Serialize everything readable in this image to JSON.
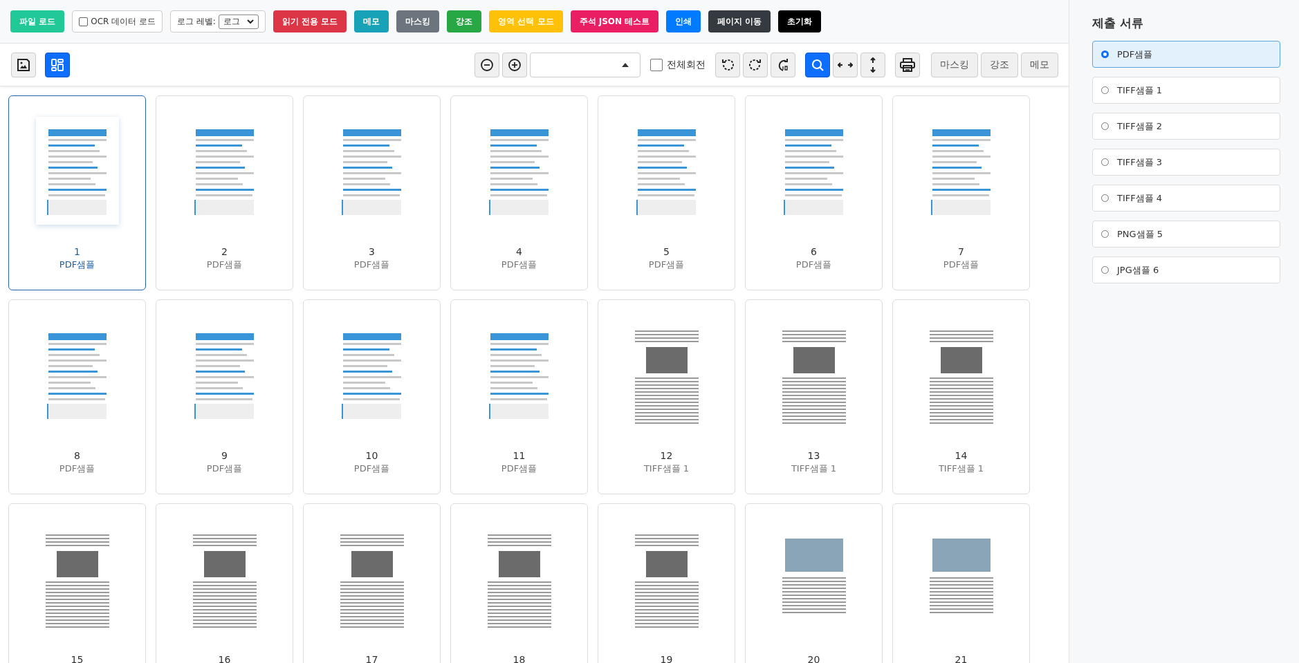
{
  "top_toolbar": {
    "buttons_left": [
      {
        "label": "파일 로드",
        "color": "#20c997"
      }
    ],
    "ocr_checkbox": {
      "label": "OCR 데이터 로드",
      "checked": false
    },
    "log_level": {
      "label": "로그 레벨:",
      "value": "로그"
    },
    "buttons": [
      {
        "label": "읽기 전용 모드",
        "color": "#dc3545"
      },
      {
        "label": "메모",
        "color": "#17a2b8"
      },
      {
        "label": "마스킹",
        "color": "#6c757d"
      },
      {
        "label": "강조",
        "color": "#28a745"
      },
      {
        "label": "영역 선택 모드",
        "color": "#ffc107"
      },
      {
        "label": "주석 JSON 테스트",
        "color": "#e91e63"
      },
      {
        "label": "인쇄",
        "color": "#007bff"
      },
      {
        "label": "페이지 이동",
        "color": "#343a40"
      },
      {
        "label": "초기화",
        "color": "#000000"
      }
    ]
  },
  "view_toolbar": {
    "left_tools": [
      {
        "kind": "save-image",
        "selected": false
      },
      {
        "kind": "thumbnails",
        "selected": true
      }
    ],
    "zoom_tools": [
      {
        "kind": "zoom-out",
        "selected": false
      },
      {
        "kind": "zoom-in",
        "selected": false
      }
    ],
    "rotate_all": {
      "label": "전체회전",
      "checked": false
    },
    "view_tools": [
      {
        "kind": "rotate-left",
        "selected": false
      },
      {
        "kind": "rotate-right",
        "selected": false
      },
      {
        "kind": "rotate-180",
        "selected": false
      },
      {
        "kind": "search",
        "selected": true
      },
      {
        "kind": "fit-width",
        "selected": false
      },
      {
        "kind": "fit-height",
        "selected": false
      },
      {
        "kind": "print",
        "selected": false
      }
    ],
    "text_buttons": [
      "마스킹",
      "강조",
      "메모"
    ]
  },
  "thumbnails": [
    {
      "number": "1",
      "name": "PDF샘플",
      "kind": "document",
      "selected": true
    },
    {
      "number": "2",
      "name": "PDF샘플",
      "kind": "document",
      "selected": false
    },
    {
      "number": "3",
      "name": "PDF샘플",
      "kind": "document",
      "selected": false
    },
    {
      "number": "4",
      "name": "PDF샘플",
      "kind": "document",
      "selected": false
    },
    {
      "number": "5",
      "name": "PDF샘플",
      "kind": "document",
      "selected": false
    },
    {
      "number": "6",
      "name": "PDF샘플",
      "kind": "document",
      "selected": false
    },
    {
      "number": "7",
      "name": "PDF샘플",
      "kind": "document",
      "selected": false
    },
    {
      "number": "8",
      "name": "PDF샘플",
      "kind": "document",
      "selected": false
    },
    {
      "number": "9",
      "name": "PDF샘플",
      "kind": "document",
      "selected": false
    },
    {
      "number": "10",
      "name": "PDF샘플",
      "kind": "document",
      "selected": false
    },
    {
      "number": "11",
      "name": "PDF샘플",
      "kind": "document",
      "selected": false
    },
    {
      "number": "12",
      "name": "TIFF샘플 1",
      "kind": "photo-page",
      "selected": false
    },
    {
      "number": "13",
      "name": "TIFF샘플 1",
      "kind": "photo-page",
      "selected": false
    },
    {
      "number": "14",
      "name": "TIFF샘플 1",
      "kind": "photo-page",
      "selected": false
    },
    {
      "number": "15",
      "kind": "photo-page",
      "selected": false
    },
    {
      "number": "16",
      "kind": "photo-page",
      "selected": false
    },
    {
      "number": "17",
      "kind": "photo-page",
      "selected": false
    },
    {
      "number": "18",
      "kind": "photo-page",
      "selected": false
    },
    {
      "number": "19",
      "kind": "photo-page",
      "selected": false
    },
    {
      "number": "20",
      "kind": "photo",
      "selected": false
    },
    {
      "number": "21",
      "kind": "photo",
      "selected": false
    }
  ],
  "sidebar": {
    "title": "제출 서류",
    "items": [
      {
        "label": "PDF샘플",
        "selected": true
      },
      {
        "label": "TIFF샘플 1",
        "selected": false
      },
      {
        "label": "TIFF샘플 2",
        "selected": false
      },
      {
        "label": "TIFF샘플 3",
        "selected": false
      },
      {
        "label": "TIFF샘플 4",
        "selected": false
      },
      {
        "label": "PNG샘플 5",
        "selected": false
      },
      {
        "label": "JPG샘플 6",
        "selected": false
      }
    ]
  }
}
